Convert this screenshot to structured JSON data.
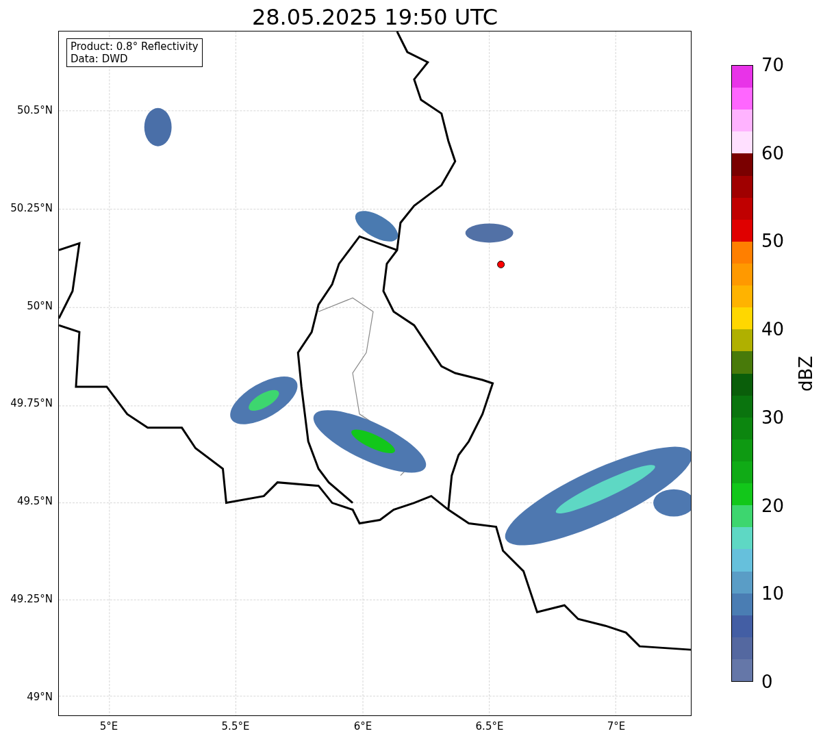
{
  "title": "28.05.2025 19:50 UTC",
  "legend": [
    "Product: 0.8° Reflectivity",
    "Data: DWD"
  ],
  "map": {
    "y_ticks": [
      "50.5°N",
      "50.25°N",
      "50°N",
      "49.75°N",
      "49.5°N",
      "49.25°N",
      "49°N"
    ],
    "x_ticks": [
      "5°E",
      "5.5°E",
      "6°E",
      "6.5°E",
      "7°E"
    ]
  },
  "colorbar": {
    "label": "dBZ",
    "ticks": [
      "70",
      "60",
      "50",
      "40",
      "30",
      "20",
      "10",
      "0"
    ],
    "bands": [
      {
        "color": "#e833e8"
      },
      {
        "color": "#ff66ff"
      },
      {
        "color": "#ffb3ff"
      },
      {
        "color": "#ffe0ff"
      },
      {
        "color": "#7a0000"
      },
      {
        "color": "#a00000"
      },
      {
        "color": "#c00000"
      },
      {
        "color": "#e00000"
      },
      {
        "color": "#ff7f00"
      },
      {
        "color": "#ff9900"
      },
      {
        "color": "#ffb300"
      },
      {
        "color": "#ffd700"
      },
      {
        "color": "#b0b000"
      },
      {
        "color": "#487a0a"
      },
      {
        "color": "#0a5e0a"
      },
      {
        "color": "#0a740e"
      },
      {
        "color": "#0c860f"
      },
      {
        "color": "#0e9a12"
      },
      {
        "color": "#10ab16"
      },
      {
        "color": "#12c71a"
      },
      {
        "color": "#3dd66f"
      },
      {
        "color": "#5ed8c4"
      },
      {
        "color": "#66c0dc"
      },
      {
        "color": "#5a9dc6"
      },
      {
        "color": "#4a7db3"
      },
      {
        "color": "#435ea4"
      },
      {
        "color": "#5468a0"
      },
      {
        "color": "#6577a8"
      }
    ]
  }
}
